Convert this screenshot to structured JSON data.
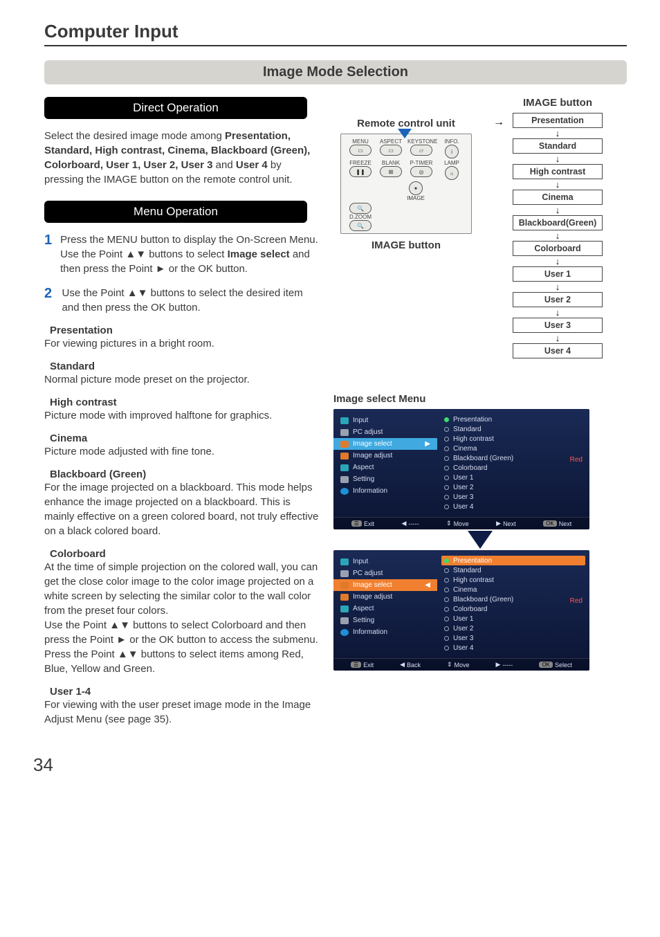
{
  "chapter_title": "Computer Input",
  "section_title": "Image Mode Selection",
  "direct_op_label": "Direct Operation",
  "menu_op_label": "Menu Operation",
  "direct_op_text_1": "Select the desired image mode among ",
  "direct_op_bold_list": "Presentation, Standard, High contrast, Cinema, Blackboard (Green), Colorboard, User 1, User 2, User 3",
  "direct_op_text_and": " and  ",
  "direct_op_bold_last": "User 4",
  "direct_op_text_2": " by pressing the IMAGE button on the remote control unit.",
  "steps": [
    {
      "num": "1",
      "pre": "Press the MENU button to display the On-Screen Menu. Use the Point ▲▼ buttons to select ",
      "bold": "Image select",
      "post": " and then press the Point ► or the OK button."
    },
    {
      "num": "2",
      "pre": "Use the Point ▲▼ buttons to select  the desired item and then press the OK button.",
      "bold": "",
      "post": ""
    }
  ],
  "modes": [
    {
      "title": "Presentation",
      "desc": "For viewing pictures in a bright room."
    },
    {
      "title": "Standard",
      "desc": "Normal picture mode preset on the projector."
    },
    {
      "title": "High contrast",
      "desc": "Picture mode with improved halftone for graphics."
    },
    {
      "title": "Cinema",
      "desc": "Picture mode adjusted with fine tone."
    },
    {
      "title": "Blackboard (Green)",
      "desc": "For the image projected on a blackboard. This mode helps enhance the image projected on a blackboard. This is mainly effective on a green colored board, not truly effective on a black colored board."
    },
    {
      "title": "Colorboard",
      "desc": "At the time of simple projection on the colored wall, you can get the close color image to the color image projected on a white screen by selecting the similar color to the wall color from the preset four colors.\nUse the Point ▲▼ buttons to select Colorboard and then press the Point ► or the OK button to access the submenu. Press the Point ▲▼ buttons to select items among Red, Blue, Yellow and Green."
    },
    {
      "title": "User 1-4",
      "desc": "For viewing with the user preset image mode in the Image Adjust Menu (see page 35)."
    }
  ],
  "remote": {
    "title": "Remote control unit",
    "caption": "IMAGE button",
    "row1": [
      "MENU",
      "ASPECT",
      "KEYSTONE",
      "INFO."
    ],
    "row2": [
      "FREEZE",
      "BLANK",
      "P-TIMER",
      "LAMP"
    ],
    "image_label": "IMAGE",
    "dzoom_label": "D.ZOOM"
  },
  "flow": {
    "title": "IMAGE button",
    "items": [
      "Presentation",
      "Standard",
      "High contrast",
      "Cinema",
      "Blackboard(Green)",
      "Colorboard",
      "User 1",
      "User 2",
      "User 3",
      "User 4"
    ]
  },
  "image_select_menu_title": "Image select Menu",
  "osd_left": [
    {
      "label": "Input",
      "icon": "teal"
    },
    {
      "label": "PC adjust",
      "icon": "gray"
    },
    {
      "label": "Image select",
      "icon": "orange"
    },
    {
      "label": "Image adjust",
      "icon": "orange"
    },
    {
      "label": "Aspect",
      "icon": "teal"
    },
    {
      "label": "Setting",
      "icon": "gray"
    },
    {
      "label": "Information",
      "icon": "info"
    }
  ],
  "osd_right": [
    "Presentation",
    "Standard",
    "High contrast",
    "Cinema",
    "Blackboard (Green)",
    "Colorboard",
    "User 1",
    "User 2",
    "User 3",
    "User 4"
  ],
  "osd_red_label": "Red",
  "osd_bar1": {
    "exit": "Exit",
    "back": "-----",
    "move": "Move",
    "next": "Next",
    "ok": "Next"
  },
  "osd_bar2": {
    "exit": "Exit",
    "back": "Back",
    "move": "Move",
    "next": "-----",
    "ok": "Select"
  },
  "page_number": "34"
}
